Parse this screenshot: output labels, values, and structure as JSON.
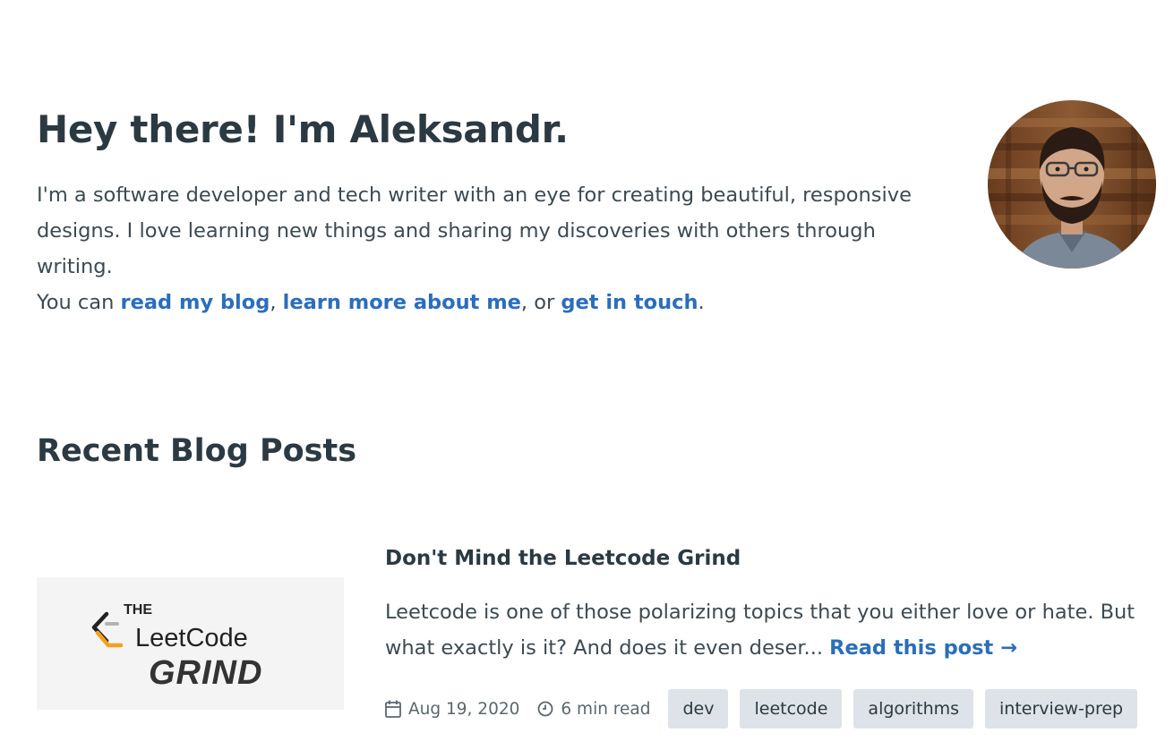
{
  "hero": {
    "heading": "Hey there! I'm Aleksandr.",
    "intro_line1": "I'm a software developer and tech writer with an eye for creating beautiful, responsive",
    "intro_line2": "designs. I love learning new things and sharing my discoveries with others through writing.",
    "intro_prefix": "You can ",
    "link_blog": "read my blog",
    "sep1": ", ",
    "link_about": "learn more about me",
    "sep2": ", or ",
    "link_contact": "get in touch",
    "suffix": "."
  },
  "recent": {
    "heading": "Recent Blog Posts"
  },
  "post": {
    "title": "Don't Mind the Leetcode Grind",
    "excerpt": "Leetcode is one of those polarizing topics that you either love or hate. But what exactly is it? And does it even deser... ",
    "read_more": "Read this post →",
    "date": "Aug 19, 2020",
    "read_time": "6 min read",
    "tags": [
      "dev",
      "leetcode",
      "algorithms",
      "interview-prep"
    ],
    "thumbnail": {
      "the": "THE",
      "leet": "LeetCode",
      "grind": "GRIND"
    }
  },
  "colors": {
    "link": "#2a6ebb",
    "text": "#2b3a42",
    "tag_bg": "#dde3e8"
  },
  "icons": {
    "date": "calendar-icon",
    "time": "clock-icon"
  }
}
